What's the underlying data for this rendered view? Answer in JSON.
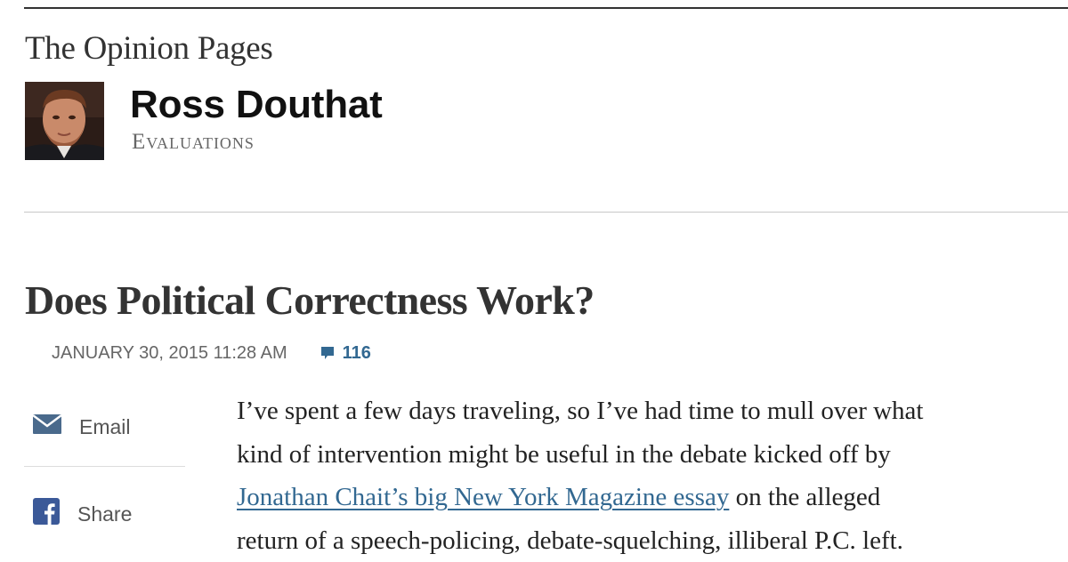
{
  "header": {
    "section_title": "The Opinion Pages",
    "author_name": "Ross Douthat",
    "blog_name": "Evaluations"
  },
  "article": {
    "headline": "Does Political Correctness Work?",
    "timestamp": "JANUARY 30, 2015 11:28 AM",
    "comment_count": "116",
    "body_lines": [
      {
        "text": "I’ve spent a few days traveling, so I’ve had time to mull over what"
      },
      {
        "text": "kind of intervention might be useful in the debate kicked off by"
      },
      {
        "link": "Jonathan Chait’s big New York Magazine essay",
        "text": " on the alleged"
      },
      {
        "text": "return of a speech-policing, debate-squelching, illiberal P.C. left."
      }
    ]
  },
  "share_tools": {
    "email_label": "Email",
    "share_label": "Share"
  },
  "icons": {
    "email": "envelope-icon",
    "facebook": "facebook-icon",
    "comments": "speech-bubble-icon"
  },
  "colors": {
    "link": "#326891",
    "facebook": "#3b5998",
    "text": "#333333"
  }
}
